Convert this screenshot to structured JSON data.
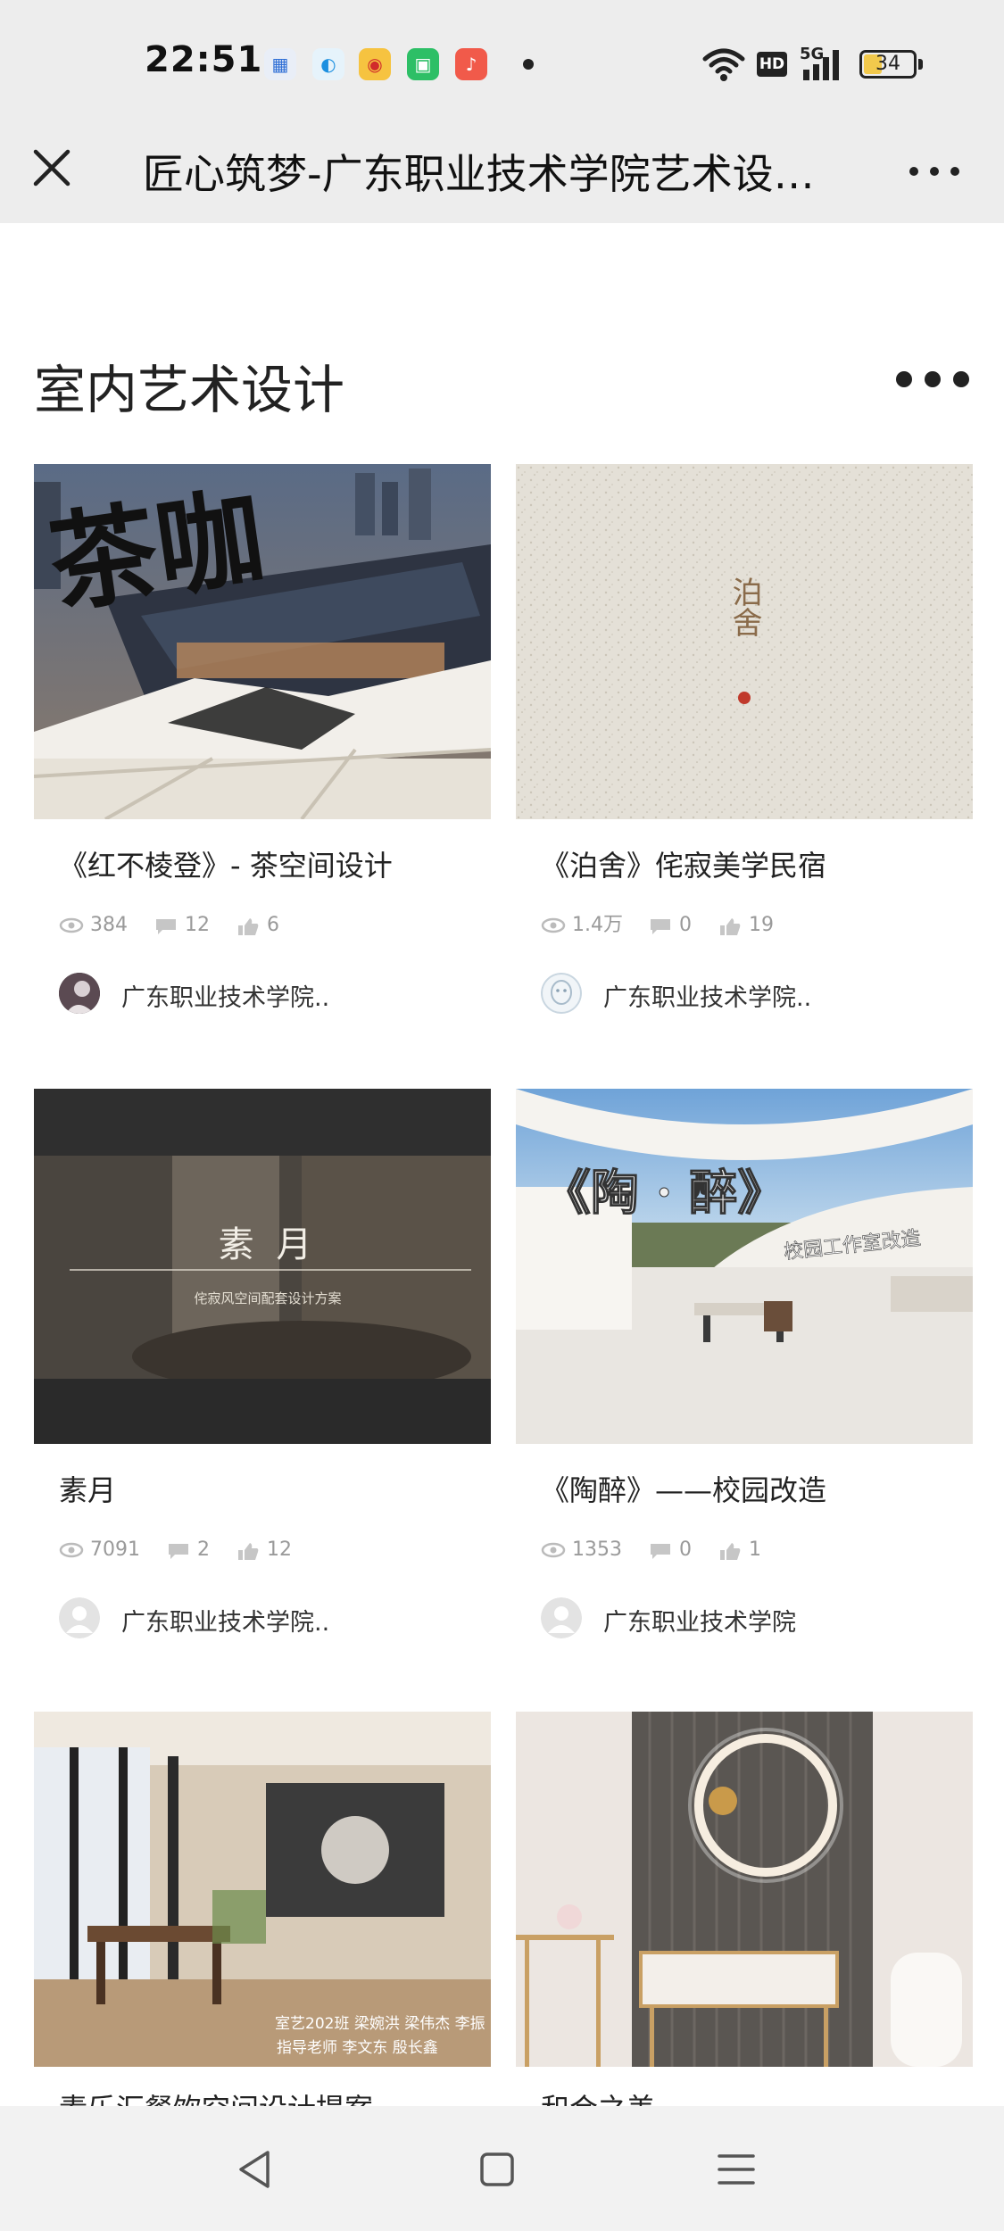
{
  "status_bar": {
    "time": "22:51",
    "network": "5G",
    "hd": "HD",
    "battery_level": "34",
    "apps": [
      "dashboard-app-icon",
      "browser-app-icon",
      "weibo-app-icon",
      "chat-app-icon",
      "music-app-icon"
    ]
  },
  "header": {
    "title": "匠心筑梦-广东职业技术学院艺术设计学院"
  },
  "section": {
    "title": "室内艺术设计"
  },
  "cards": [
    {
      "title": "《红不棱登》- 茶空间设计",
      "views": "384",
      "comments": "12",
      "likes": "6",
      "author": "广东职业技术学院..",
      "image_text": "茶咖"
    },
    {
      "title": "《泊舍》侘寂美学民宿",
      "views": "1.4万",
      "comments": "0",
      "likes": "19",
      "author": "广东职业技术学院..",
      "image_text": "泊舍"
    },
    {
      "title": "素月",
      "views": "7091",
      "comments": "2",
      "likes": "12",
      "author": "广东职业技术学院..",
      "image_text": "素  月",
      "image_subtext": "侘寂风空间配套设计方案"
    },
    {
      "title": "《陶醉》——校园改造",
      "views": "1353",
      "comments": "0",
      "likes": "1",
      "author": "广东职业技术学院",
      "image_text": "《陶 · 醉》",
      "image_subtext": "校园工作室改造"
    },
    {
      "title": "素乐汇餐饮空间设计提案",
      "image_text": "室艺202班  梁婉洪  梁伟杰  李振",
      "image_subtext": "指导老师  李文东  殷长鑫"
    },
    {
      "title": "和合之美"
    }
  ],
  "colors": {
    "bar_bg": "#ededed",
    "text": "#222222",
    "meta": "#9a9a9a"
  }
}
